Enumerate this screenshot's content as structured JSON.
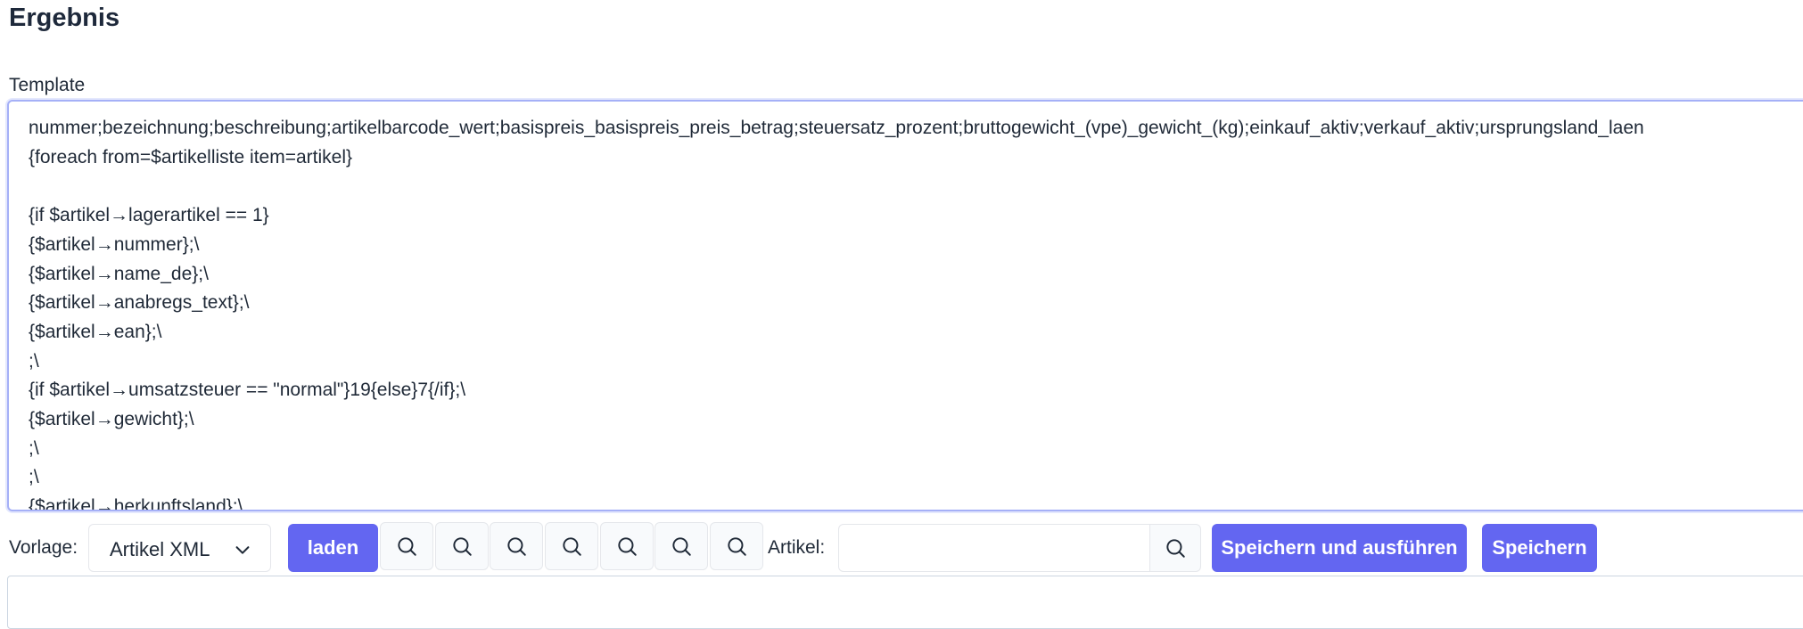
{
  "page": {
    "title": "Ergebnis"
  },
  "template": {
    "label": "Template",
    "lines": [
      "nummer;bezeichnung;beschreibung;artikelbarcode_wert;basispreis_basispreis_preis_betrag;steuersatz_prozent;bruttogewicht_(vpe)_gewicht_(kg);einkauf_aktiv;verkauf_aktiv;ursprungsland_laen",
      "{foreach from=$artikelliste item=artikel}",
      "",
      "{if $artikel→lagerartikel == 1}",
      "{$artikel→nummer};\\",
      "{$artikel→name_de};\\",
      "{$artikel→anabregs_text};\\",
      "{$artikel→ean};\\",
      ";\\",
      "{if $artikel→umsatzsteuer == \"normal\"}19{else}7{/if};\\",
      "{$artikel→gewicht};\\",
      ";\\",
      ";\\",
      "{$artikel→herkunftsland};\\"
    ]
  },
  "toolbar": {
    "vorlage_label": "Vorlage:",
    "vorlage_value": "Artikel XML",
    "laden_label": "laden",
    "search_icon_count": 7,
    "artikel_label": "Artikel:",
    "artikel_value": "",
    "save_run_label": "Speichern und ausführen",
    "save_label": "Speichern"
  },
  "icons": {
    "search": "search-icon",
    "chevron": "chevron-down-icon"
  },
  "colors": {
    "primary": "#6366f1",
    "focus_border": "#a5b0f7",
    "heading": "#1e293b"
  }
}
